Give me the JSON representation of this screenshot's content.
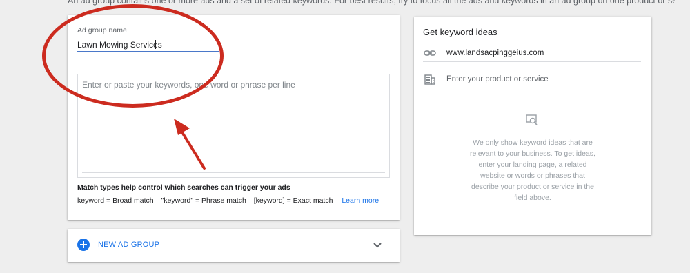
{
  "intro_text": "An ad group contains one or more ads and a set of related keywords. For best results, try to focus all the ads and keywords in an ad group on one product or service.",
  "ad_group": {
    "name_label": "Ad group name",
    "name_value": "Lawn Mowing Services",
    "keywords_placeholder": "Enter or paste your keywords, one word or phrase per line"
  },
  "match_types": {
    "title": "Match types help control which searches can trigger your ads",
    "broad": "keyword = Broad match",
    "phrase": "\"keyword\" = Phrase match",
    "exact": "[keyword] = Exact match",
    "learn_more": "Learn more"
  },
  "new_ad_group": {
    "label": "NEW AD GROUP",
    "icon": "plus-circle-icon",
    "chevron": "chevron-down-icon"
  },
  "keyword_ideas": {
    "title": "Get keyword ideas",
    "url_value": "www.landsacpinggeius.com",
    "product_placeholder": "Enter your product or service",
    "info_text": "We only show keyword ideas that are relevant to your business. To get ideas, enter your landing page, a related website or words or phrases that describe your product or service in the field above."
  },
  "colors": {
    "accent": "#1a73e8",
    "annotation": "#cc2b1f",
    "input_underline": "#4a78c9"
  }
}
